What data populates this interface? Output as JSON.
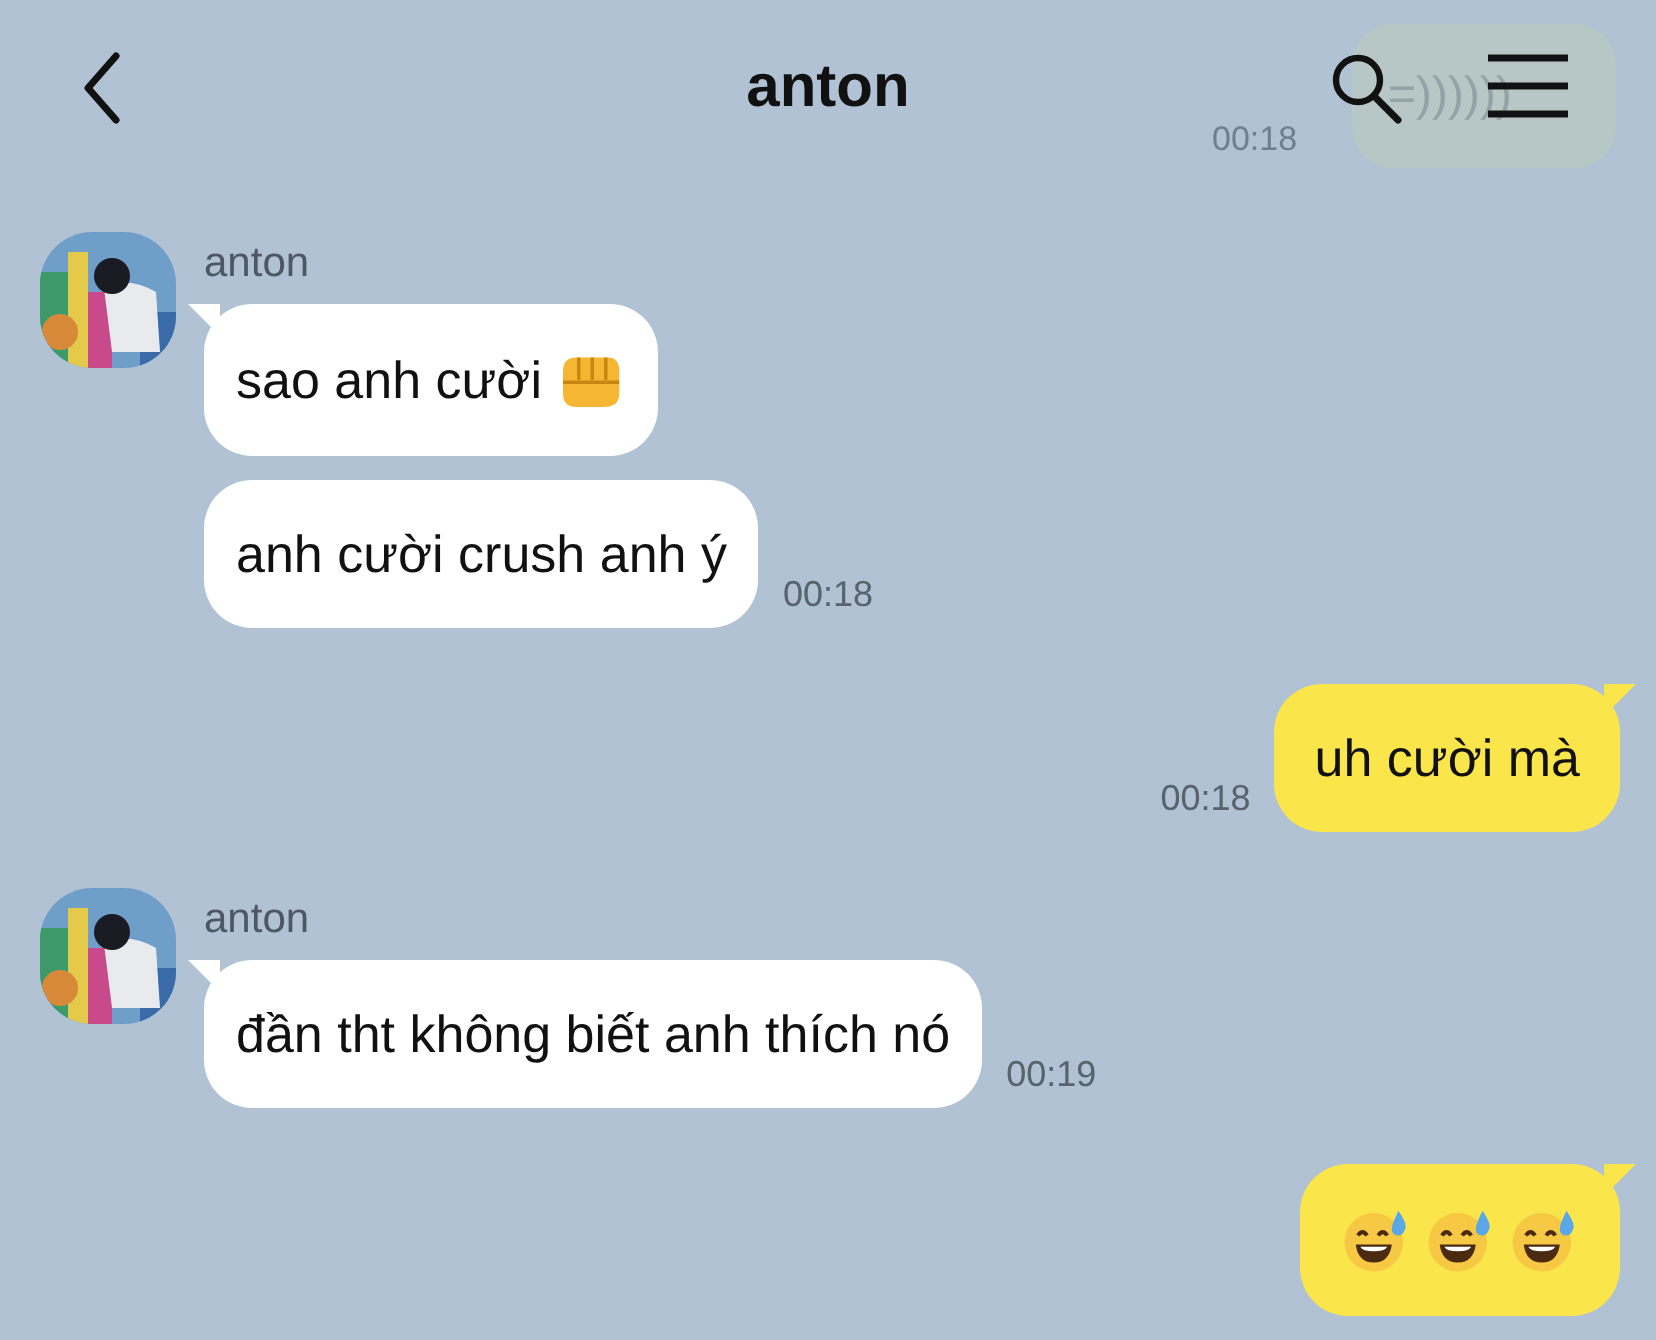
{
  "header": {
    "title": "anton",
    "behind": {
      "text": "=))))))",
      "time": "00:18"
    }
  },
  "groups": [
    {
      "kind": "incoming",
      "sender": "anton",
      "messages": [
        {
          "kind": "text-fist",
          "text": "sao anh cười"
        },
        {
          "kind": "text",
          "text": "anh cười crush anh ý",
          "time": "00:18"
        }
      ]
    },
    {
      "kind": "outgoing",
      "messages": [
        {
          "kind": "text",
          "text": "uh cười mà",
          "time": "00:18"
        }
      ]
    },
    {
      "kind": "incoming",
      "sender": "anton",
      "messages": [
        {
          "kind": "text",
          "text": "đần tht không biết anh thích nó",
          "time": "00:19"
        }
      ]
    },
    {
      "kind": "outgoing",
      "messages": [
        {
          "kind": "smileys"
        }
      ]
    }
  ]
}
